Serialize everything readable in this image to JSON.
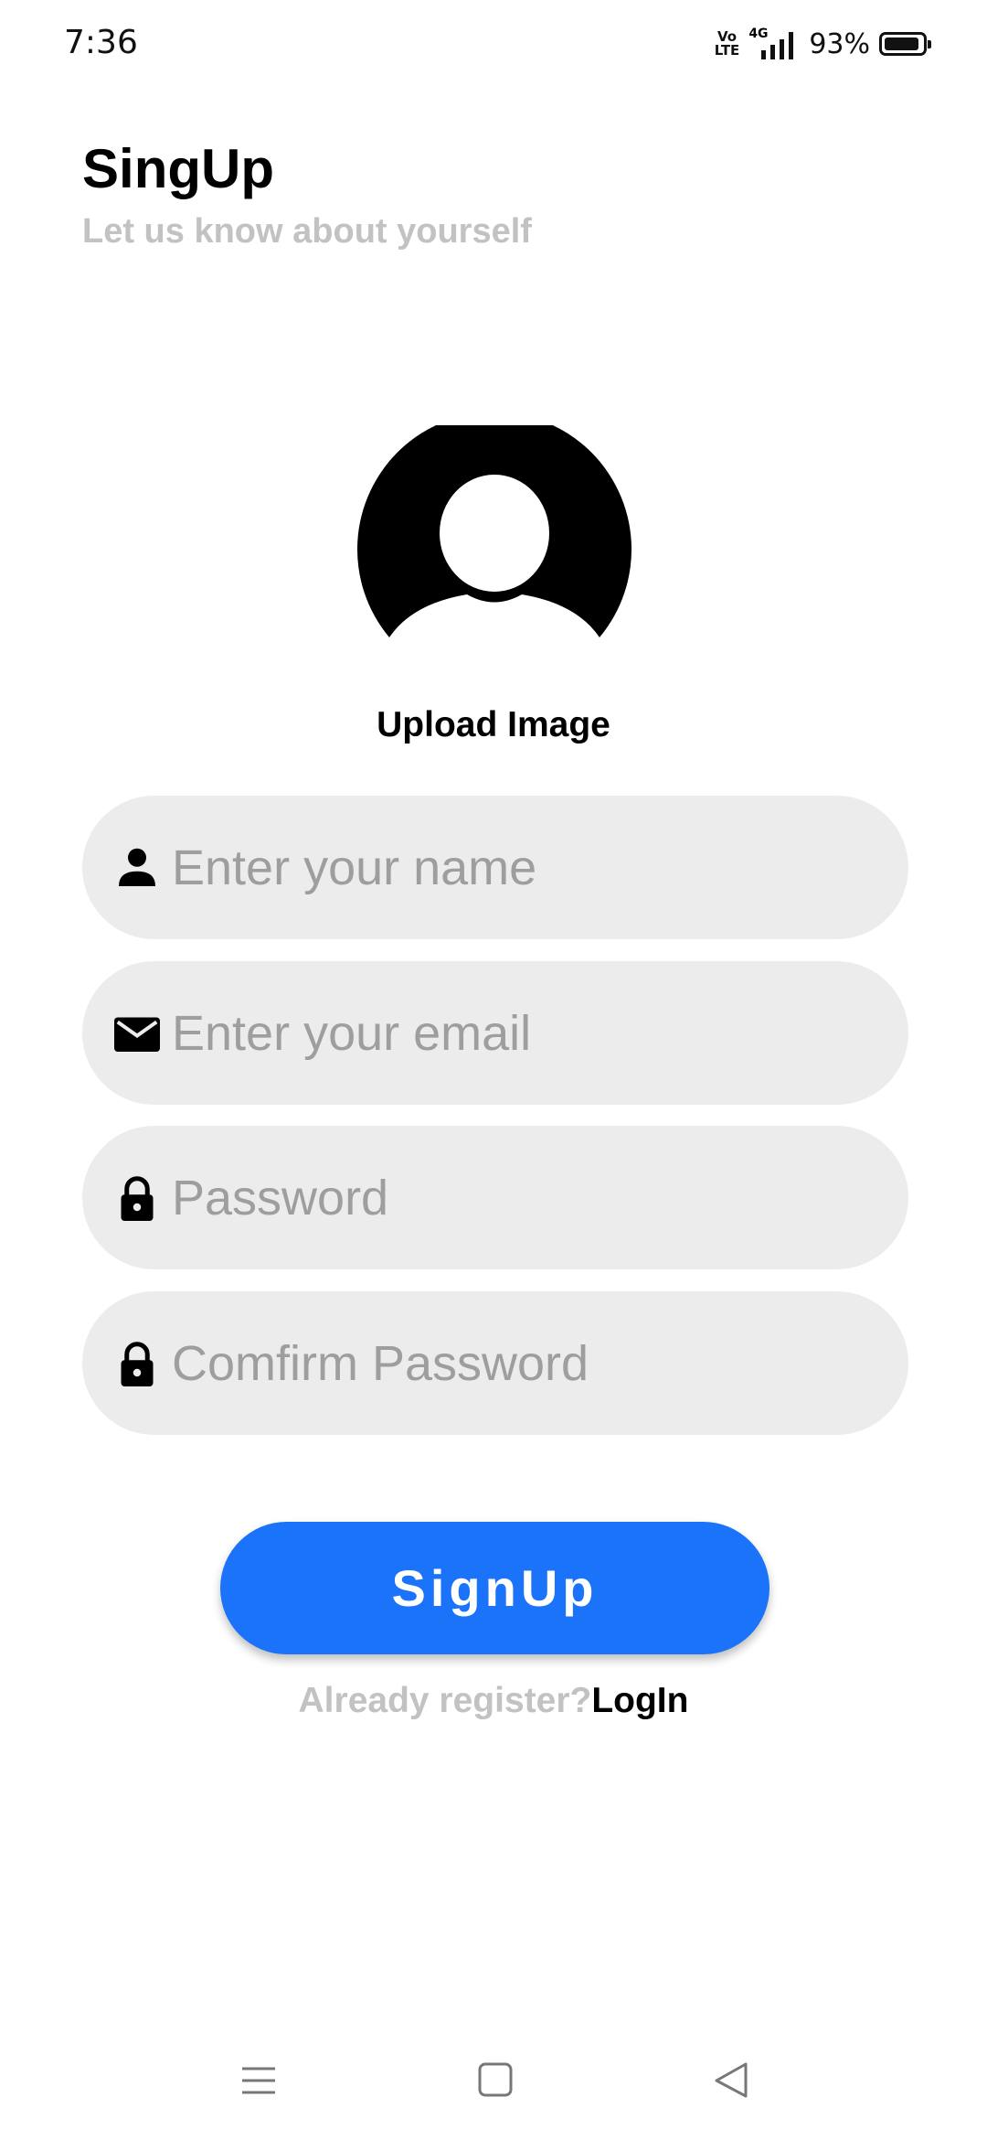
{
  "status_bar": {
    "time": "7:36",
    "volte": "Vo LTE",
    "network": "4G",
    "battery_percent": "93%",
    "battery_level": 0.93
  },
  "header": {
    "title": "SingUp",
    "subtitle": "Let us know about yourself"
  },
  "avatar": {
    "icon": "default-user-avatar-icon",
    "label": "Upload Image"
  },
  "form": {
    "fields": [
      {
        "icon": "person-icon",
        "placeholder": "Enter your name",
        "value": ""
      },
      {
        "icon": "mail-icon",
        "placeholder": "Enter your email",
        "value": ""
      },
      {
        "icon": "lock-icon",
        "placeholder": "Password",
        "value": ""
      },
      {
        "icon": "lock-icon",
        "placeholder": "Comfirm Password",
        "value": ""
      }
    ],
    "submit_label": "SignUp",
    "login_prompt": "Already register?",
    "login_link": "LogIn"
  },
  "nav_bar": {
    "items": [
      "menu-icon",
      "home-square-icon",
      "back-triangle-icon"
    ]
  },
  "colors": {
    "primary": "#1a73f8",
    "field_bg": "#ececec",
    "muted_text": "#c2c2c2",
    "placeholder": "#9e9e9e"
  }
}
